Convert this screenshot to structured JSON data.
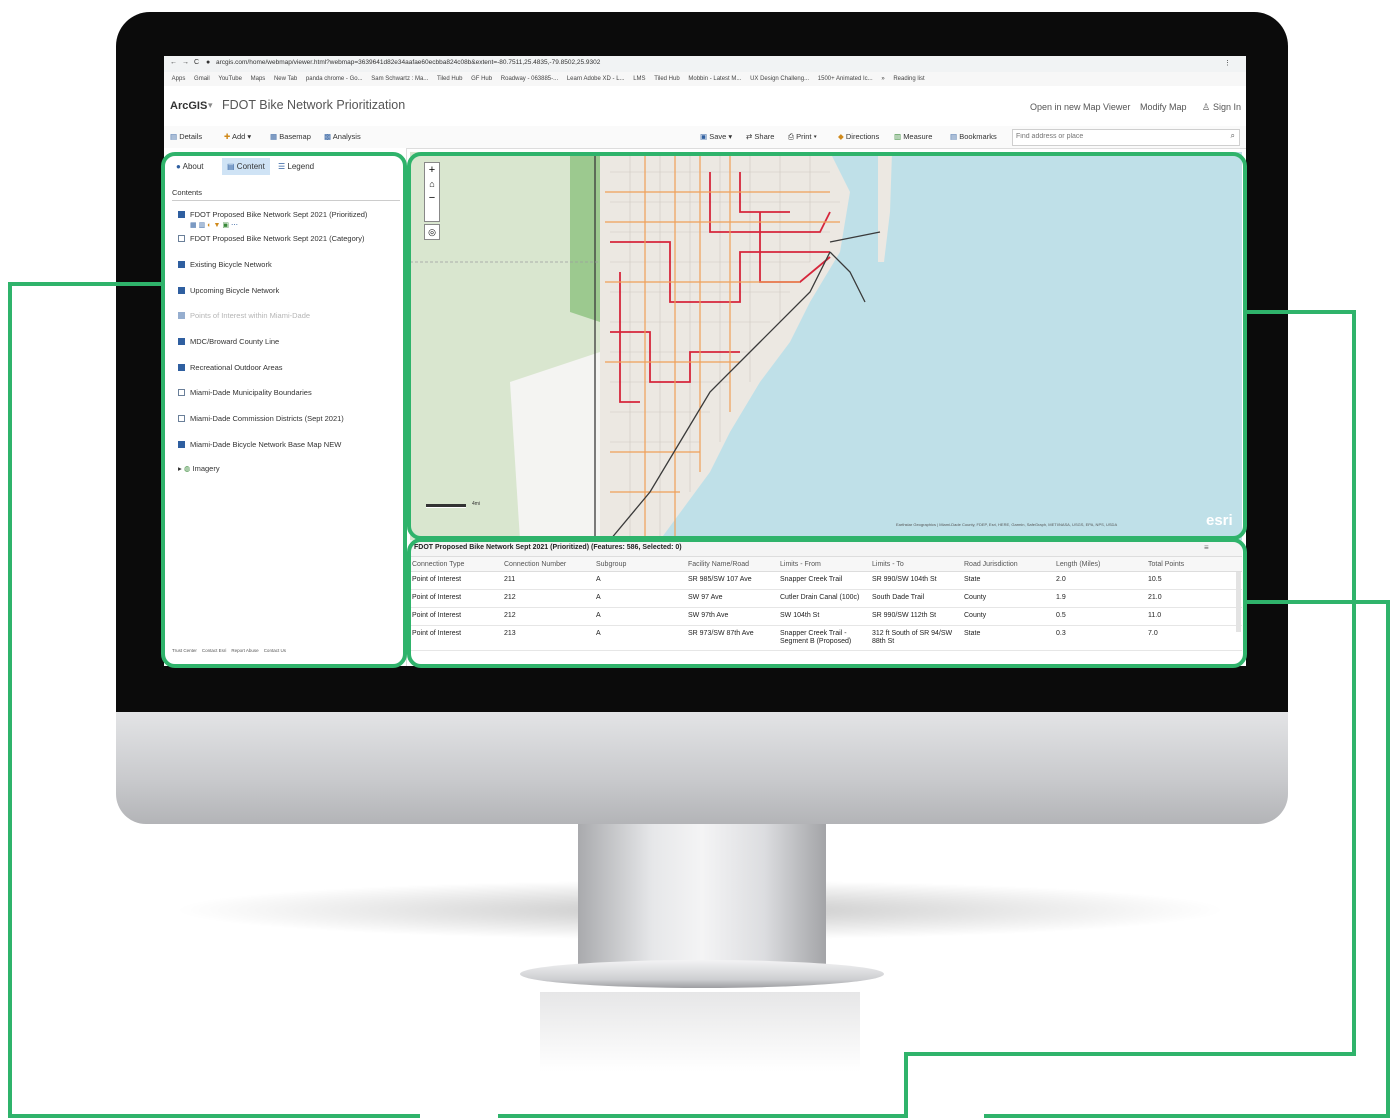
{
  "browser": {
    "url": "arcgis.com/home/webmap/viewer.html?webmap=3639641d82e34aafae60ecbba824c08b&extent=-80.7511,25.4835,-79.8502,25.9302",
    "bookmarks": [
      "Apps",
      "Gmail",
      "YouTube",
      "Maps",
      "New Tab",
      "panda chrome - Go...",
      "Sam Schwartz : Ma...",
      "Tiled Hub",
      "GF Hub",
      "Roadway - 063885-...",
      "Learn Adobe XD - L...",
      "LMS",
      "Tiled Hub",
      "Mobbin - Latest M...",
      "UX Design Challeng...",
      "1500+ Animated Ic...",
      "»",
      "Reading list"
    ]
  },
  "app": {
    "logo": "ArcGIS",
    "title": "FDOT Bike Network Prioritization",
    "header_links": [
      "Open in new Map Viewer",
      "Modify Map",
      "Sign In"
    ]
  },
  "toolbar": {
    "details": "Details",
    "add": "Add",
    "basemap": "Basemap",
    "analysis": "Analysis",
    "save": "Save",
    "share": "Share",
    "print": "Print",
    "directions": "Directions",
    "measure": "Measure",
    "bookmarks": "Bookmarks",
    "search_placeholder": "Find address or place"
  },
  "panel": {
    "tabs": [
      "About",
      "Content",
      "Legend"
    ],
    "heading": "Contents",
    "layers": [
      {
        "label": "FDOT Proposed Bike Network Sept 2021 (Prioritized)",
        "checked": true
      },
      {
        "label": "FDOT Proposed Bike Network Sept 2021 (Category)",
        "checked": false
      },
      {
        "label": "Existing Bicycle Network",
        "checked": true
      },
      {
        "label": "Upcoming Bicycle Network",
        "checked": true
      },
      {
        "label": "Points of Interest within Miami-Dade",
        "checked": true
      },
      {
        "label": "MDC/Broward County Line",
        "checked": true
      },
      {
        "label": "Recreational Outdoor Areas",
        "checked": true
      },
      {
        "label": "Miami-Dade Municipality Boundaries",
        "checked": false
      },
      {
        "label": "Miami-Dade Commission Districts (Sept 2021)",
        "checked": false
      },
      {
        "label": "Miami-Dade Bicycle Network Base Map NEW",
        "checked": true
      }
    ],
    "imagery": "Imagery",
    "footer": [
      "Trust Center",
      "Contact Esri",
      "Report Abuse",
      "Contact Us"
    ]
  },
  "map": {
    "attribution": "Earthstar Geographics | Miami-Dade County, FDEP, Esri, HERE, Garmin, SafeGraph, METI/NASA, USGS, EPA, NPS, USDA",
    "scale_label": "4mi",
    "esri_logo": "esri"
  },
  "table": {
    "title": "FDOT Proposed Bike Network Sept 2021 (Prioritized) (Features: 586, Selected: 0)",
    "columns": [
      "Connection Type",
      "Connection Number",
      "Subgroup",
      "Facility Name/Road",
      "Limits - From",
      "Limits - To",
      "Road Jurisdiction",
      "Length (Miles)",
      "Total Points"
    ],
    "rows": [
      [
        "Point of Interest",
        "211",
        "A",
        "SR 985/SW 107 Ave",
        "Snapper Creek Trail",
        "SR 990/SW 104th St",
        "State",
        "2.0",
        "10.5"
      ],
      [
        "Point of Interest",
        "212",
        "A",
        "SW 97 Ave",
        "Cutler Drain Canal (100c)",
        "South Dade Trail",
        "County",
        "1.9",
        "21.0"
      ],
      [
        "Point of Interest",
        "212",
        "A",
        "SW 97th Ave",
        "SW 104th St",
        "SR 990/SW 112th St",
        "County",
        "0.5",
        "11.0"
      ],
      [
        "Point of Interest",
        "213",
        "A",
        "SR 973/SW 87th Ave",
        "Snapper Creek Trail - Segment B (Proposed)",
        "312 ft South of SR 94/SW 88th St",
        "State",
        "0.3",
        "7.0"
      ]
    ]
  }
}
